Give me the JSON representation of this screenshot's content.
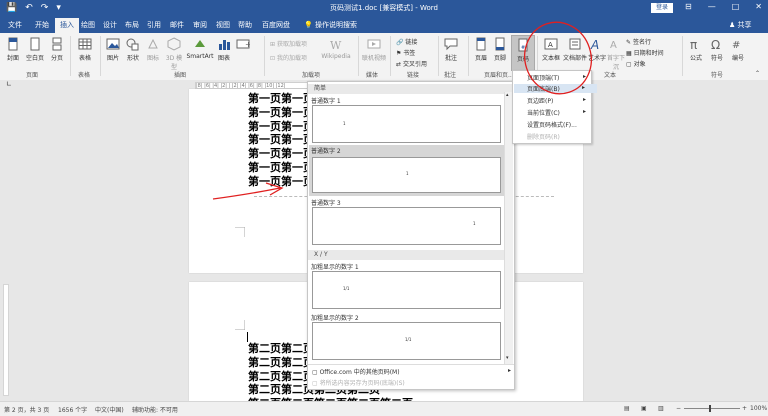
{
  "titlebar": {
    "title": "页码测试1.doc [兼容模式] - Word",
    "login": "登录",
    "qat": [
      "💾",
      "↶",
      "↷",
      "▾"
    ],
    "win_controls": [
      "⊟",
      "—",
      "□",
      "✕"
    ]
  },
  "tabs": {
    "items": [
      "文件",
      "开始",
      "插入",
      "绘图",
      "设计",
      "布局",
      "引用",
      "邮件",
      "审阅",
      "视图",
      "帮助",
      "百度网盘"
    ],
    "active": "插入",
    "tell_me": "操作说明搜索",
    "share": "共享"
  },
  "ribbon": {
    "buttons": {
      "cover": "封面",
      "blank": "空白页",
      "pagebreak": "分页",
      "table": "表格",
      "picture": "图片",
      "shapes": "形状",
      "icons": "图标",
      "model3d": "3D 模型",
      "smartart": "SmartArt",
      "chart": "图表",
      "screenshot": "屏幕截图",
      "wikipedia": "Wikipedia",
      "video": "联机视频",
      "comment": "批注",
      "header": "页眉",
      "footer": "页脚",
      "pagenum": "页码",
      "textbox": "文本框",
      "docparts": "文档部件",
      "wordart": "艺术字",
      "dropcap": "首字下沉",
      "equation": "公式",
      "symbol": "符号",
      "number": "编号"
    },
    "small": {
      "get_addins": "获取加载项",
      "my_addins": "我的加载项",
      "link": "链接",
      "bookmark": "书签",
      "crossref": "交叉引用",
      "signature": "签名行",
      "datetime": "日期和时间",
      "object": "对象"
    },
    "groups": {
      "pages": "页面",
      "tables": "表格",
      "illustrations": "插图",
      "addins": "加载项",
      "media": "媒体",
      "links": "链接",
      "comments": "批注",
      "headerfooter": "页眉和页...",
      "text": "文本",
      "symbols": "符号"
    }
  },
  "ruler_text": "|8| |6| |4| |2| | |2| |4| |6| |8| |10| |12|",
  "page1_lines": [
    "第一页第一页",
    "第一页第一页",
    "第一页第一页",
    "第一页第一页",
    "第一页第一页",
    "第一页第一页",
    "第一页第一页"
  ],
  "page2_lines": [
    "第二页第二页",
    "第二页第二页",
    "第二页第二页",
    "第二页第二页第二页第二页",
    "第二页第二页第二页第二页第二页"
  ],
  "gallery": {
    "head_simple": "简单",
    "items": [
      {
        "label": "普通数字 1",
        "marker": "1"
      },
      {
        "label": "普通数字 2",
        "marker": "1"
      },
      {
        "label": "普通数字 3",
        "marker": "1"
      }
    ],
    "head_xy": "X / Y",
    "items2": [
      {
        "label": "加粗显示的数字 1",
        "marker": "1/1"
      },
      {
        "label": "加粗显示的数字 2",
        "marker": "1/1"
      }
    ],
    "more": "Office.com 中的其他页码(M)",
    "save": "将所选内容另存为页码(底端)(S)"
  },
  "menu": {
    "items": [
      {
        "label": "页面顶端(T)",
        "state": "normal"
      },
      {
        "label": "页面底端(B)",
        "state": "highlight"
      },
      {
        "label": "页边距(P)",
        "state": "normal"
      },
      {
        "label": "当前位置(C)",
        "state": "normal"
      },
      {
        "label": "设置页码格式(F)...",
        "state": "normal"
      },
      {
        "label": "删除页码(R)",
        "state": "disabled"
      }
    ]
  },
  "status": {
    "page": "第 2 页，共 3 页",
    "words": "1656 个字",
    "lang": "中文(中国)",
    "accessibility": "辅助功能: 不可用",
    "zoom": "100%"
  },
  "colors": {
    "brand": "#2b579a",
    "annotation": "#e02020"
  }
}
